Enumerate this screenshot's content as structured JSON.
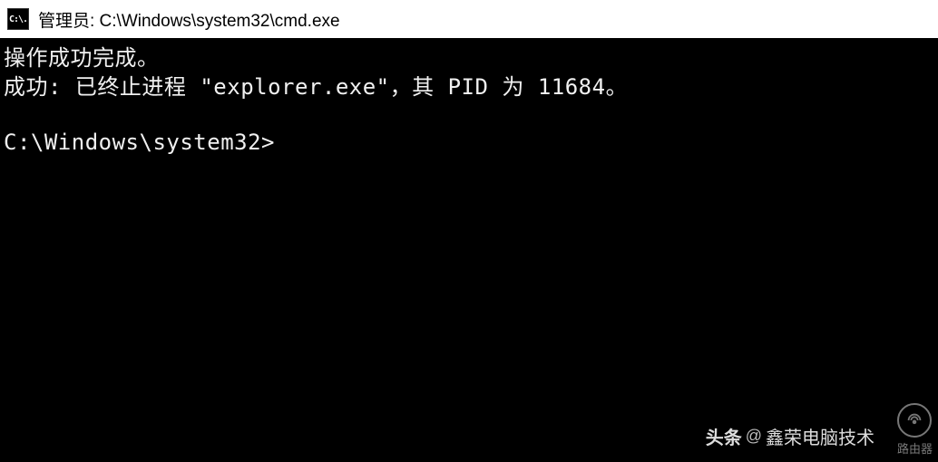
{
  "titlebar": {
    "icon_label": "C:\\.",
    "title": "管理员: C:\\Windows\\system32\\cmd.exe"
  },
  "terminal": {
    "line1": "操作成功完成。",
    "line2": "成功: 已终止进程 \"explorer.exe\"，其 PID 为 11684。",
    "prompt": "C:\\Windows\\system32>"
  },
  "watermark": {
    "toutiao_label": "头条",
    "toutiao_at": "@",
    "toutiao_author": "鑫荣电脑技术",
    "router_label": "路由器"
  }
}
